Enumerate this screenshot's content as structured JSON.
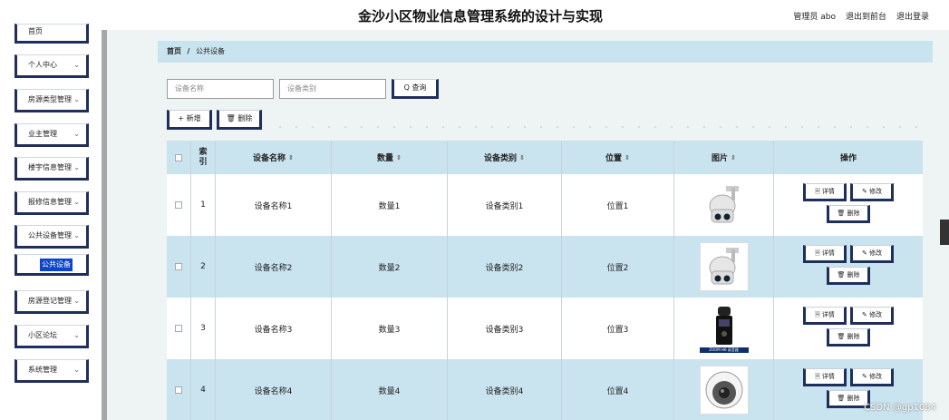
{
  "header": {
    "title": "金沙小区物业信息管理系统的设计与实现",
    "admin": "管理员 abo",
    "front": "退出到前台",
    "logout": "退出登录"
  },
  "sidebar": {
    "items": [
      {
        "label": "首页"
      },
      {
        "label": "个人中心"
      },
      {
        "label": "房源类型管理"
      },
      {
        "label": "业主管理"
      },
      {
        "label": "楼宇信息管理"
      },
      {
        "label": "报修信息管理"
      },
      {
        "label": "公共设备管理"
      },
      {
        "label": "房源登记管理"
      },
      {
        "label": "小区论坛"
      },
      {
        "label": "系统管理"
      }
    ],
    "sub_active": "公共设备",
    "chevron": "⌄"
  },
  "breadcrumb": {
    "home": "首页",
    "sep": "/",
    "current": "公共设备"
  },
  "search": {
    "name_placeholder": "设备名称",
    "type_placeholder": "设备类别",
    "query_label": "Q 查询"
  },
  "actions": {
    "add_label": "+ 新增",
    "delete_label": "🗑 删除"
  },
  "table": {
    "headers": {
      "index": "索引",
      "name": "设备名称",
      "qty": "数量",
      "category": "设备类别",
      "position": "位置",
      "image": "图片",
      "ops": "操作"
    },
    "sort_icon": "⇕",
    "rows": [
      {
        "index": "1",
        "name": "设备名称1",
        "qty": "数量1",
        "category": "设备类别1",
        "position": "位置1",
        "image": "camera-ptz"
      },
      {
        "index": "2",
        "name": "设备名称2",
        "qty": "数量2",
        "category": "设备类别2",
        "position": "位置2",
        "image": "camera-ptz"
      },
      {
        "index": "3",
        "name": "设备名称3",
        "qty": "数量3",
        "category": "设备类别3",
        "position": "位置3",
        "image": "recorder",
        "image_caption": "ZOOM H6 录音器"
      },
      {
        "index": "4",
        "name": "设备名称4",
        "qty": "数量4",
        "category": "设备类别4",
        "position": "位置4",
        "image": "camera-dome"
      }
    ],
    "op_labels": {
      "detail": "🗏 详情",
      "edit": "✎ 修改",
      "delete": "🗑 删除"
    }
  },
  "watermark": "CSDN @gp1084",
  "colors": {
    "accent": "#1f2f5c",
    "table_header": "#c9e3ef",
    "active_sub": "#0a44c9"
  }
}
